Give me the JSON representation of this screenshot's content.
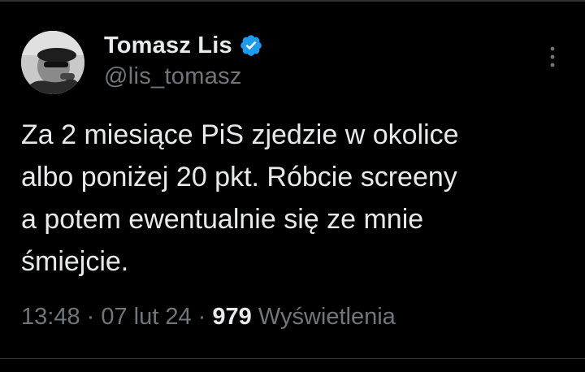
{
  "tweet": {
    "author": {
      "display_name": "Tomasz Lis",
      "handle": "@lis_tomasz",
      "verified": true,
      "avatar_icon": "user-avatar-photo",
      "verified_icon": "verified-badge-icon"
    },
    "more_icon": "more-options-icon",
    "text": "Za 2 miesiące PiS zjedzie w okolice\nalbo poniżej 20 pkt. Róbcie screeny\na potem ewentualnie się ze mnie\nśmiejcie.",
    "time": "13:48",
    "separator": " · ",
    "date": "07 lut 24",
    "views_count": "979",
    "views_label": " Wyświetlenia"
  },
  "colors": {
    "background": "#000000",
    "text": "#e7e9ea",
    "secondary_text": "#71767b",
    "verified": "#1d9bf0",
    "divider": "#2f3336"
  }
}
